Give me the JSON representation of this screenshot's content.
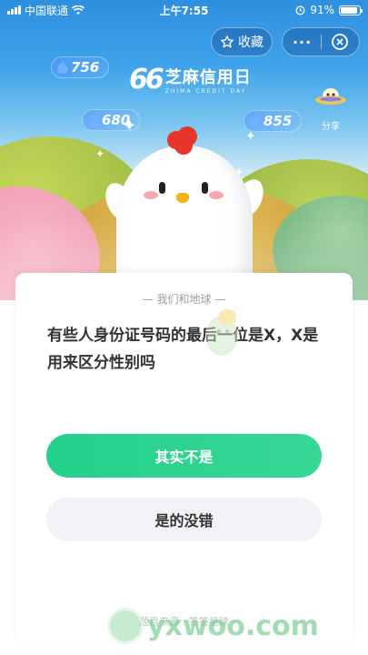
{
  "status_bar": {
    "carrier": "中国联通",
    "time": "上午7:55",
    "battery_percent": "91%",
    "battery_level": 0.91
  },
  "toolbar": {
    "favorite_label": "收藏",
    "more_label": "···"
  },
  "scores": [
    "756",
    "680",
    "855"
  ],
  "logo": {
    "mark": "66",
    "title": "芝麻信用日",
    "subtitle": "ZHIMA CREDIT DAY"
  },
  "share_label": "分享",
  "card": {
    "topic": "— 我们和地球 —",
    "question": "有些人身份证号码的最后一位是X，X是用来区分性别吗",
    "answers": [
      "其实不是",
      "是的没错"
    ],
    "source": "题目来源 · 答答星球"
  },
  "watermark": "yxwoo.com",
  "colors": {
    "accent_green": "#2cd38e",
    "sky_blue": "#3ea3ea"
  }
}
